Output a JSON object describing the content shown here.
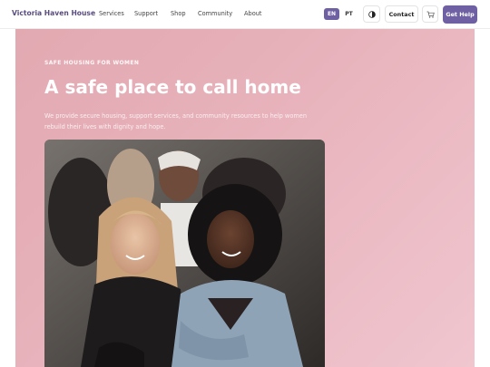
{
  "header": {
    "brand": "Victoria Haven House",
    "nav": [
      "Services",
      "Support",
      "Shop",
      "Community",
      "About"
    ],
    "languages": [
      "EN",
      "PT"
    ],
    "active_language": "EN",
    "contact_label": "Contact",
    "cta_label": "Get Help"
  },
  "hero": {
    "eyebrow": "SAFE HOUSING FOR WOMEN",
    "headline": "A safe place to call home",
    "subtitle": "We provide secure housing, support services, and community resources to help women rebuild their lives with dignity and hope."
  },
  "colors": {
    "brand": "#5a4c80",
    "accent": "#6f5fa3",
    "hero_bg": "#e6b0b9"
  },
  "icons": [
    "theme-toggle-icon",
    "cart-icon"
  ]
}
